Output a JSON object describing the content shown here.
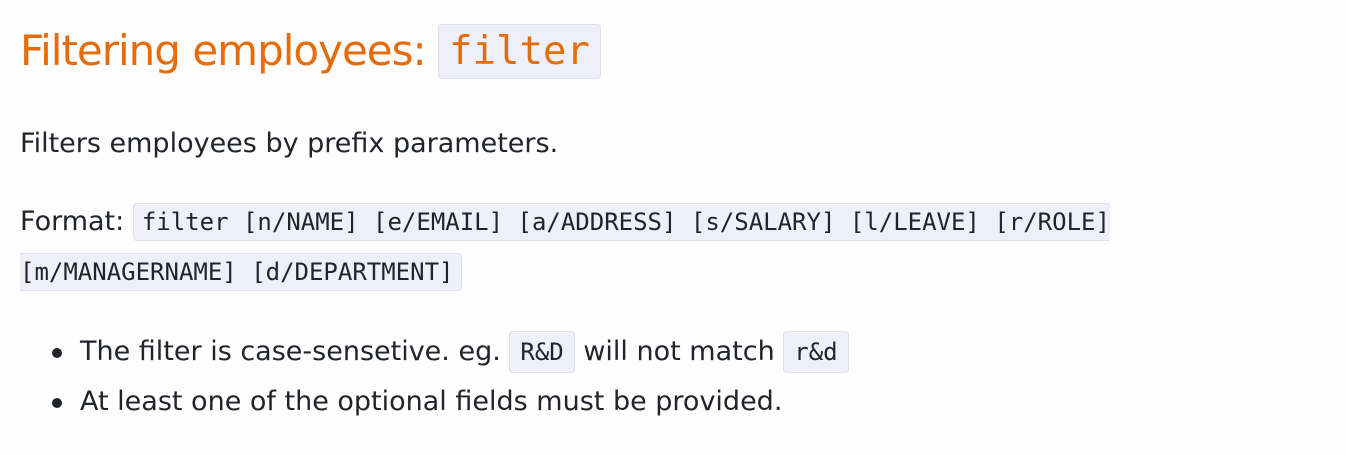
{
  "heading": {
    "text": "Filtering employees: ",
    "code": "filter"
  },
  "description": "Filters employees by prefix parameters.",
  "format": {
    "label": "Format: ",
    "code": "filter [n/NAME] [e/EMAIL] [a/ADDRESS] [s/SALARY] [l/LEAVE] [r/ROLE] [m/MANAGERNAME] [d/DEPARTMENT]"
  },
  "notes": [
    {
      "prefix": "The filter is case-sensetive. eg. ",
      "code1": "R&D",
      "middle": " will not match ",
      "code2": "r&d"
    },
    {
      "text": "At least one of the optional fields must be provided."
    }
  ]
}
